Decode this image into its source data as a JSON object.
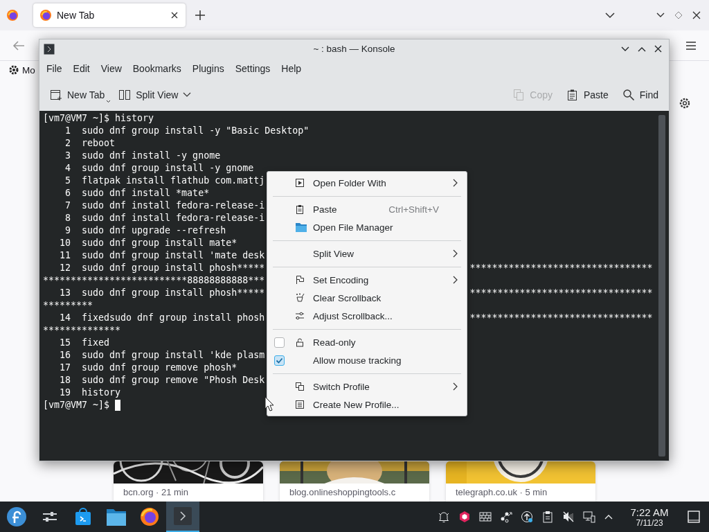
{
  "browser": {
    "tabs": [
      {
        "label": "New Tab",
        "selected": true
      }
    ],
    "bookmarks": [
      {
        "label": "Mo"
      }
    ],
    "cards": [
      {
        "caption": "bcn.org · 21 min",
        "kind": "dark"
      },
      {
        "caption": "blog.onlineshoppingtools.c",
        "kind": "person"
      },
      {
        "caption": "telegraph.co.uk · 5 min",
        "kind": "yellow"
      }
    ]
  },
  "konsole": {
    "title": "~ : bash — Konsole",
    "menu": [
      "File",
      "Edit",
      "View",
      "Bookmarks",
      "Plugins",
      "Settings",
      "Help"
    ],
    "toolbar_left": [
      {
        "label": "New Tab",
        "kind": "new-tab",
        "disabled": false
      },
      {
        "label": "Split View",
        "kind": "split",
        "disabled": false
      }
    ],
    "toolbar_right": [
      {
        "label": "Copy",
        "kind": "copy",
        "disabled": true
      },
      {
        "label": "Paste",
        "kind": "paste",
        "disabled": false
      },
      {
        "label": "Find",
        "kind": "find",
        "disabled": false
      }
    ],
    "terminal": {
      "lines": [
        {
          "kind": "prompt",
          "text": "[vm7@VM7 ~]$ history"
        },
        {
          "kind": "entry",
          "num": "1",
          "cmd": "sudo dnf group install -y \"Basic Desktop\""
        },
        {
          "kind": "entry",
          "num": "2",
          "cmd": "reboot"
        },
        {
          "kind": "entry",
          "num": "3",
          "cmd": "sudo dnf install -y gnome"
        },
        {
          "kind": "entry",
          "num": "4",
          "cmd": "sudo dnf group install -y gnome"
        },
        {
          "kind": "entry",
          "num": "5",
          "cmd": "flatpak install flathub com.mattj"
        },
        {
          "kind": "entry",
          "num": "6",
          "cmd": "sudo dnf install *mate*"
        },
        {
          "kind": "entry",
          "num": "7",
          "cmd": "sudo dnf install fedora-release-i"
        },
        {
          "kind": "entry",
          "num": "8",
          "cmd": "sudo dnf install fedora-release-i"
        },
        {
          "kind": "entry",
          "num": "9",
          "cmd": "sudo dnf upgrade --refresh"
        },
        {
          "kind": "entry",
          "num": "10",
          "cmd": "sudo dnf group install mate*"
        },
        {
          "kind": "entry",
          "num": "11",
          "cmd": "sudo dnf group install 'mate desk"
        },
        {
          "kind": "entry",
          "num": "12",
          "cmd": "sudo dnf group install phosh*****",
          "tail": "*********************************"
        },
        {
          "kind": "wrap",
          "text": "**************************88888888888***"
        },
        {
          "kind": "entry",
          "num": "13",
          "cmd": "sudo dnf group install phosh*****",
          "tail": "*********************************"
        },
        {
          "kind": "wrap",
          "text": "*********"
        },
        {
          "kind": "entry",
          "num": "14",
          "cmd": "fixedsudo dnf group install phosh",
          "tail": "*********************************"
        },
        {
          "kind": "wrap",
          "text": "**************"
        },
        {
          "kind": "entry",
          "num": "15",
          "cmd": "fixed"
        },
        {
          "kind": "entry",
          "num": "16",
          "cmd": "sudo dnf group install 'kde plasm"
        },
        {
          "kind": "entry",
          "num": "17",
          "cmd": "sudo dnf group remove phosh*"
        },
        {
          "kind": "entry",
          "num": "18",
          "cmd": "sudo dnf group remove \"Phosh Desk"
        },
        {
          "kind": "entry",
          "num": "19",
          "cmd": "history"
        },
        {
          "kind": "input",
          "text": "[vm7@VM7 ~]$ "
        }
      ]
    }
  },
  "context_menu": {
    "items": [
      {
        "kind": "open-with",
        "label": "Open Folder With",
        "submenu": true
      },
      {
        "kind": "separator"
      },
      {
        "kind": "paste",
        "label": "Paste",
        "shortcut": "Ctrl+Shift+V",
        "submenu": false
      },
      {
        "kind": "folder",
        "label": "Open File Manager",
        "submenu": false
      },
      {
        "kind": "separator"
      },
      {
        "kind": "plain",
        "label": "Split View",
        "submenu": true
      },
      {
        "kind": "separator"
      },
      {
        "kind": "flag",
        "label": "Set Encoding",
        "submenu": true
      },
      {
        "kind": "brush",
        "label": "Clear Scrollback",
        "submenu": false
      },
      {
        "kind": "sliders",
        "label": "Adjust Scrollback...",
        "submenu": false
      },
      {
        "kind": "separator"
      },
      {
        "kind": "lock",
        "label": "Read-only",
        "checked": false
      },
      {
        "kind": "plain",
        "label": "Allow mouse tracking",
        "checked": true
      },
      {
        "kind": "separator"
      },
      {
        "kind": "switch",
        "label": "Switch Profile",
        "submenu": true
      },
      {
        "kind": "form",
        "label": "Create New Profile...",
        "submenu": false
      }
    ]
  },
  "taskbar": {
    "apps": [
      {
        "kind": "launcher",
        "selected": false
      },
      {
        "kind": "settings",
        "selected": false
      },
      {
        "kind": "store",
        "selected": false
      },
      {
        "kind": "files",
        "selected": false
      },
      {
        "kind": "browser",
        "selected": false
      },
      {
        "kind": "terminal",
        "selected": true
      }
    ],
    "tray": [
      {
        "kind": "bell"
      },
      {
        "kind": "cube"
      },
      {
        "kind": "keyboard"
      },
      {
        "kind": "nodes"
      },
      {
        "kind": "update"
      },
      {
        "kind": "clipboard"
      },
      {
        "kind": "mute"
      },
      {
        "kind": "network"
      },
      {
        "kind": "caret"
      }
    ],
    "time": "7:22 AM",
    "date": "7/11/23"
  }
}
